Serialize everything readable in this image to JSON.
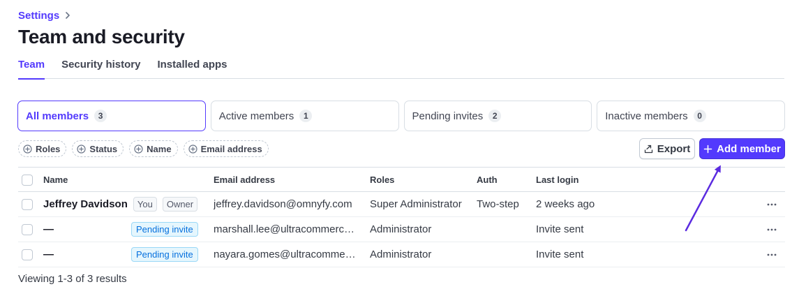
{
  "breadcrumb": {
    "parent": "Settings"
  },
  "page_title": "Team and security",
  "tabs": [
    {
      "label": "Team",
      "active": true
    },
    {
      "label": "Security history",
      "active": false
    },
    {
      "label": "Installed apps",
      "active": false
    }
  ],
  "filter_cards": [
    {
      "label": "All members",
      "count": "3",
      "active": true
    },
    {
      "label": "Active members",
      "count": "1",
      "active": false
    },
    {
      "label": "Pending invites",
      "count": "2",
      "active": false
    },
    {
      "label": "Inactive members",
      "count": "0",
      "active": false
    }
  ],
  "filter_chips": [
    "Roles",
    "Status",
    "Name",
    "Email address"
  ],
  "toolbar": {
    "export_label": "Export",
    "add_member_label": "Add member"
  },
  "table": {
    "columns": {
      "name": "Name",
      "email": "Email address",
      "roles": "Roles",
      "auth": "Auth",
      "last_login": "Last login"
    },
    "rows": [
      {
        "name": "Jeffrey Davidson",
        "badges": [
          "You",
          "Owner"
        ],
        "email": "jeffrey.davidson@omnyfy.com",
        "role": "Super Administrator",
        "auth": "Two-step",
        "last_login": "2 weeks ago"
      },
      {
        "name": "—",
        "status_badge": "Pending invite",
        "email": "marshall.lee@ultracommerce…",
        "role": "Administrator",
        "auth": "",
        "last_login": "Invite sent"
      },
      {
        "name": "—",
        "status_badge": "Pending invite",
        "email": "nayara.gomes@ultracommer…",
        "role": "Administrator",
        "auth": "",
        "last_login": "Invite sent"
      }
    ]
  },
  "results_text": "Viewing 1-3 of 3 results",
  "colors": {
    "accent": "#533afd",
    "pending_badge_text": "#0570de",
    "pending_badge_bg": "#e5f6fd"
  },
  "icons": [
    "chevron-right-icon",
    "plus-circle-icon",
    "export-icon",
    "plus-icon",
    "more-horizontal-icon",
    "annotation-arrow"
  ]
}
